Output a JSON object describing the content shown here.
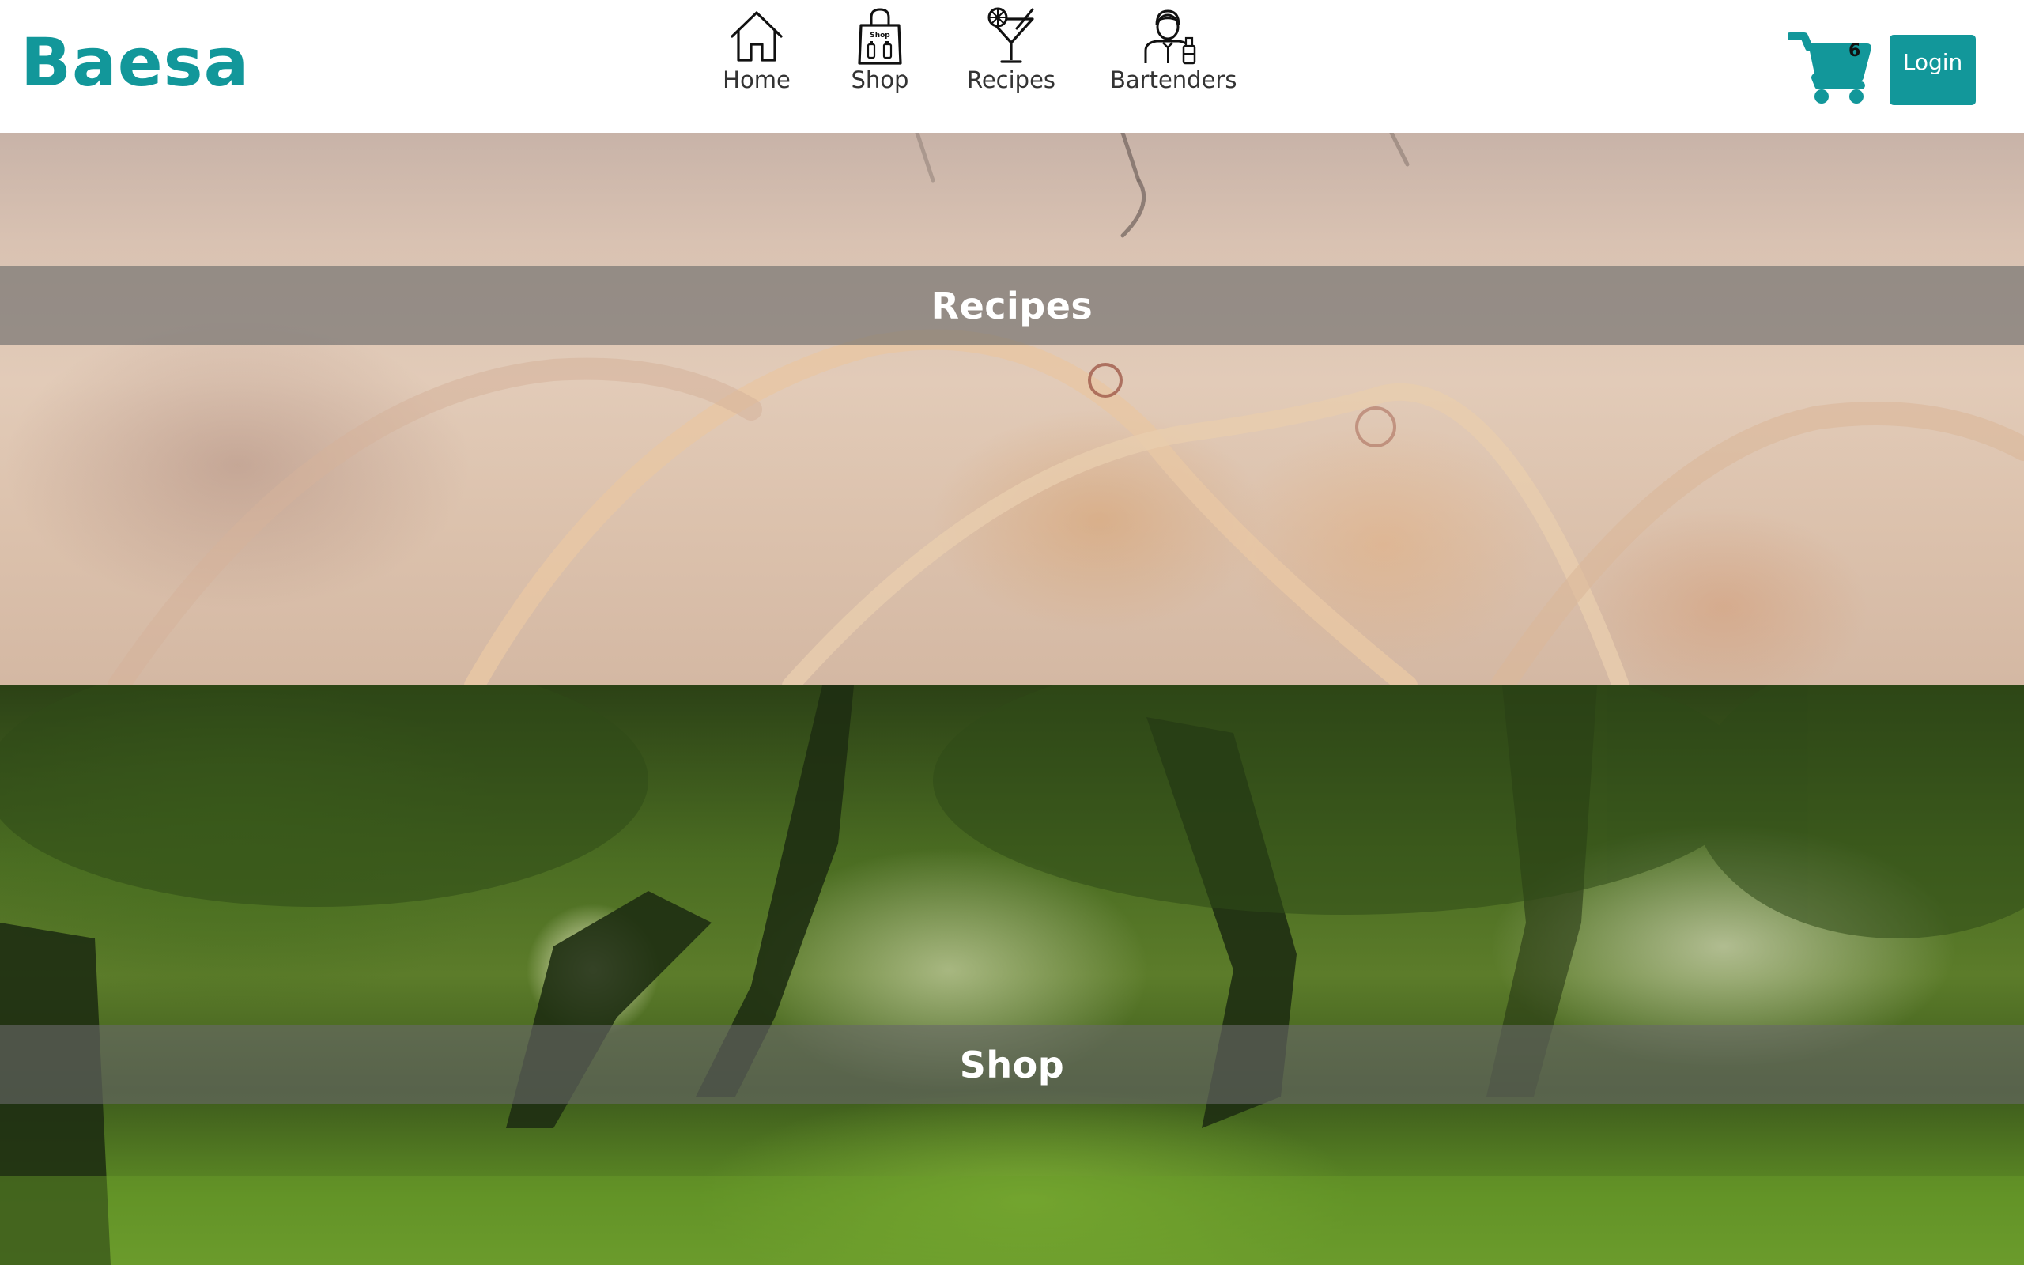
{
  "header": {
    "logo": "Baesa",
    "nav": [
      {
        "label": "Home",
        "icon": "home-icon"
      },
      {
        "label": "Shop",
        "icon": "shop-bag-icon",
        "icon_text": "Shop"
      },
      {
        "label": "Recipes",
        "icon": "cocktail-icon"
      },
      {
        "label": "Bartenders",
        "icon": "bartender-icon"
      }
    ],
    "cart": {
      "icon": "cart-icon",
      "count": "6"
    },
    "login_label": "Login"
  },
  "sections": [
    {
      "title": "Recipes"
    },
    {
      "title": "Shop"
    }
  ],
  "colors": {
    "brand": "#12979a",
    "band_overlay": "rgba(105,105,105,0.62)",
    "text_dark": "#333333"
  }
}
